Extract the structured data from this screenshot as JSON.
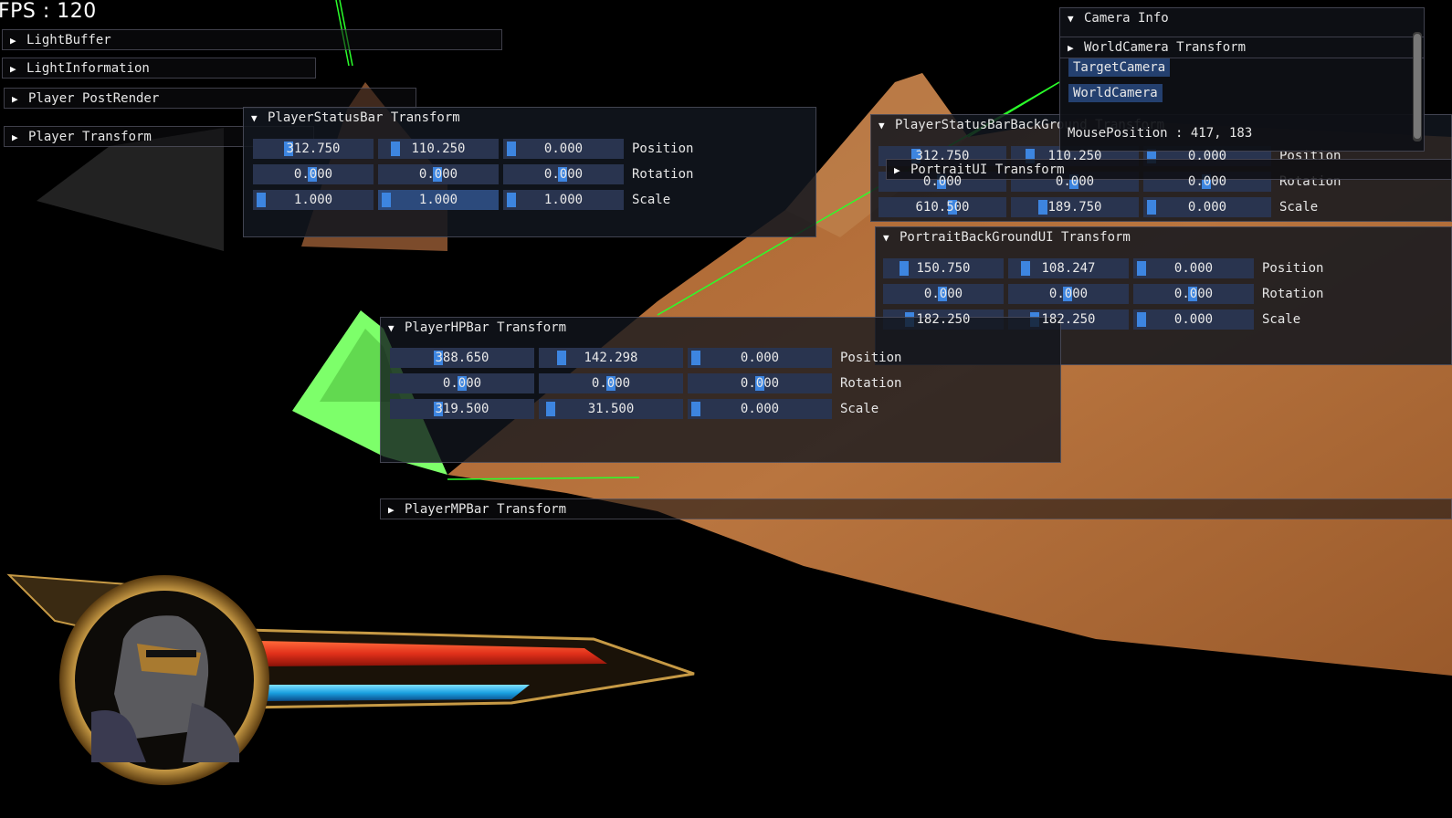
{
  "hud": {
    "fps_label": "FPS : 120"
  },
  "panels": {
    "light_buffer": {
      "title": "LightBuffer"
    },
    "light_information": {
      "title": "LightInformation"
    },
    "player_post_render": {
      "title": "Player PostRender"
    },
    "player_transform": {
      "title": "Player Transform"
    },
    "player_status_bar": {
      "title": "PlayerStatusBar Transform",
      "rows": [
        {
          "label": "Position",
          "values": [
            "312.750",
            "110.250",
            "0.000"
          ]
        },
        {
          "label": "Rotation",
          "values": [
            "0.000",
            "0.000",
            "0.000"
          ]
        },
        {
          "label": "Scale",
          "values": [
            "1.000",
            "1.000",
            "1.000"
          ]
        }
      ]
    },
    "player_status_bar_background": {
      "title": "PlayerStatusBarBackGround Transform",
      "rows": [
        {
          "label": "Position",
          "values": [
            "312.750",
            "110.250",
            "0.000"
          ]
        },
        {
          "label": "Rotation",
          "values": [
            "0.000",
            "0.000",
            "0.000"
          ]
        },
        {
          "label": "Scale",
          "values": [
            "610.500",
            "189.750",
            "0.000"
          ]
        }
      ]
    },
    "portrait_ui": {
      "title": "PortraitUI Transform"
    },
    "portrait_background_ui": {
      "title": "PortraitBackGroundUI Transform",
      "rows": [
        {
          "label": "Position",
          "values": [
            "150.750",
            "108.247",
            "0.000"
          ]
        },
        {
          "label": "Rotation",
          "values": [
            "0.000",
            "0.000",
            "0.000"
          ]
        },
        {
          "label": "Scale",
          "values": [
            "182.250",
            "182.250",
            "0.000"
          ]
        }
      ]
    },
    "player_hp_bar": {
      "title": "PlayerHPBar Transform",
      "rows": [
        {
          "label": "Position",
          "values": [
            "388.650",
            "142.298",
            "0.000"
          ]
        },
        {
          "label": "Rotation",
          "values": [
            "0.000",
            "0.000",
            "0.000"
          ]
        },
        {
          "label": "Scale",
          "values": [
            "319.500",
            "31.500",
            "0.000"
          ]
        }
      ]
    },
    "player_mp_bar": {
      "title": "PlayerMPBar Transform"
    },
    "camera_info": {
      "title": "Camera Info",
      "world_camera_header": "WorldCamera Transform",
      "buttons": [
        "TargetCamera",
        "WorldCamera"
      ],
      "mouse_position": "MousePosition : 417, 183"
    }
  },
  "colors": {
    "panel_bg": "#12161e",
    "field_bg": "#29344f",
    "grab": "#3d85e0",
    "terrain": "#b06a35",
    "hp": "#e0301a",
    "mp": "#1aa0e0"
  }
}
